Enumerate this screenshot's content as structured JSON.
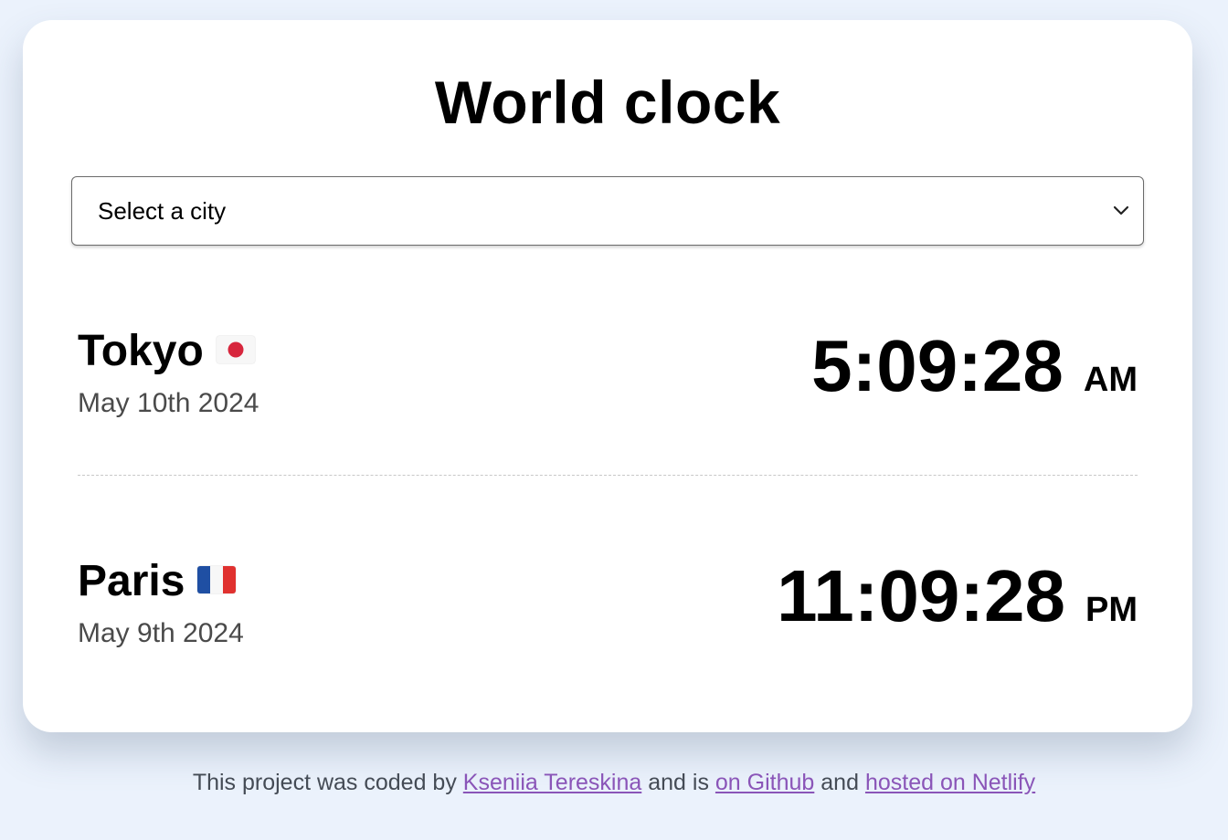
{
  "app": {
    "title": "World clock"
  },
  "city_select": {
    "selected_label": "Select a city",
    "icon": "chevron-down-icon"
  },
  "cities": [
    {
      "name": "Tokyo",
      "flag": "japan-flag-icon",
      "date": "May 10th 2024",
      "time": "5:09:28",
      "ampm": "AM"
    },
    {
      "name": "Paris",
      "flag": "france-flag-icon",
      "date": "May 9th 2024",
      "time": "11:09:28",
      "ampm": "PM"
    }
  ],
  "footer": {
    "text_1": "This project was coded by",
    "author_link": "Kseniia Tereskina",
    "text_2": "and is",
    "github_link": "on Github",
    "text_3": "and",
    "netlify_link": "hosted on Netlify"
  },
  "colors": {
    "page_background": "#ebf2fc",
    "card_background": "#ffffff",
    "link": "#8a55b8",
    "date_text": "#4a4a4a"
  }
}
